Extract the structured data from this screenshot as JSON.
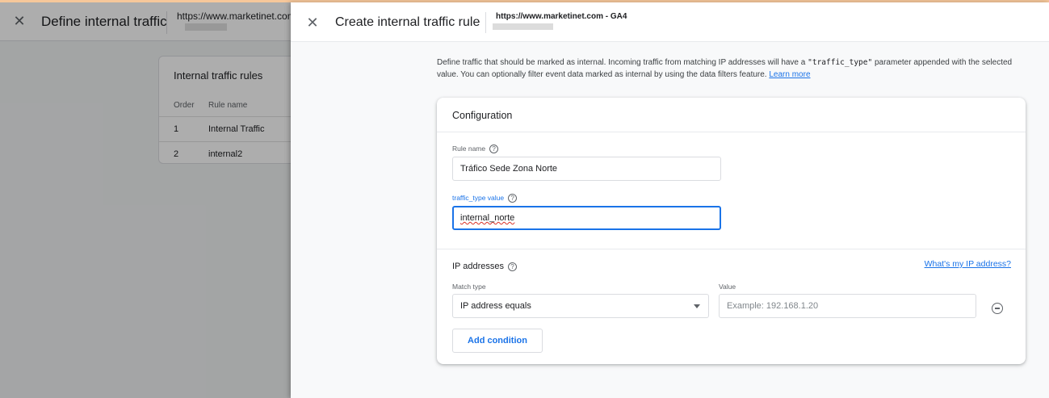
{
  "background": {
    "title": "Define internal traffic",
    "property_url": "https://www.marketinet.com",
    "card": {
      "title": "Internal traffic rules",
      "columns": [
        "Order",
        "Rule name"
      ],
      "rows": [
        {
          "order": "1",
          "name": "Internal Traffic"
        },
        {
          "order": "2",
          "name": "internal2"
        }
      ]
    }
  },
  "drawer": {
    "title": "Create internal traffic rule",
    "property_url": "https://www.marketinet.com - GA4",
    "intro": {
      "text_before": "Define traffic that should be marked as internal. Incoming traffic from matching IP addresses will have a ",
      "code": "\"traffic_type\"",
      "text_after": " parameter appended with the selected value. You can optionally filter event data marked as internal by using the data filters feature. ",
      "link": "Learn more"
    },
    "configuration": {
      "title": "Configuration",
      "rule_name": {
        "label": "Rule name",
        "value": "Tráfico Sede Zona Norte"
      },
      "traffic_type": {
        "label": "traffic_type value",
        "value": "internal_norte"
      },
      "ip": {
        "title": "IP addresses",
        "whats_my_ip": "What's my IP address?",
        "match_type_label": "Match type",
        "match_type_value": "IP address equals",
        "value_label": "Value",
        "value_placeholder": "Example: 192.168.1.20",
        "add_condition": "Add condition"
      }
    }
  },
  "icons": {
    "close": "close-icon",
    "help": "help-icon",
    "dropdown": "chevron-down-icon",
    "remove": "remove-circle-icon"
  },
  "colors": {
    "accent": "#1a73e8",
    "top_strip": "#f6c79a"
  }
}
